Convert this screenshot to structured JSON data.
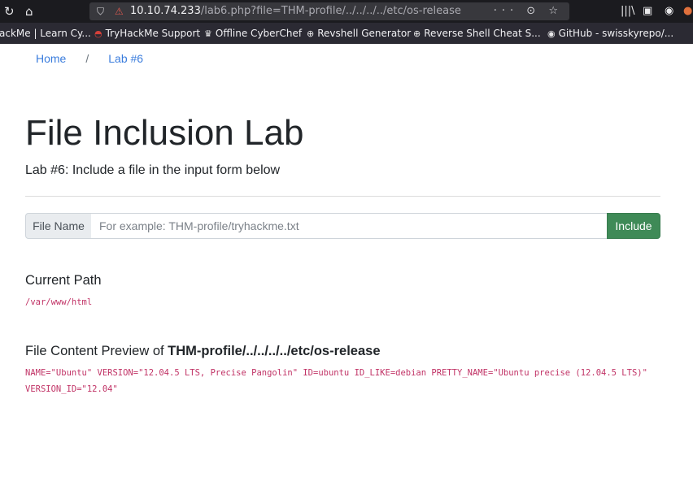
{
  "browser": {
    "toolbar": {
      "reload_icon": "reload-icon",
      "home_icon": "home-icon",
      "shield_icon": "shield-icon",
      "insecure_lock_icon": "insecure-lock-icon",
      "url_host": "10.10.74.233",
      "url_rest": "/lab6.php?file=THM-profile/../../../../etc/os-release",
      "page_actions_icons": "···  ⊙  ☆",
      "library_icon": "library-icon",
      "sidebar_icon": "sidebar-icon",
      "account_icon": "account-icon"
    },
    "bookmarks": [
      {
        "label": "ackMe | Learn Cy...",
        "icon": "tryhackme-icon"
      },
      {
        "label": "TryHackMe Support",
        "icon": "tryhackme-support-icon"
      },
      {
        "label": "Offline CyberChef",
        "icon": "cyberchef-icon"
      },
      {
        "label": "Revshell Generator",
        "icon": "globe-icon"
      },
      {
        "label": "Reverse Shell Cheat S...",
        "icon": "globe-icon"
      },
      {
        "label": "GitHub - swisskyrepo/...",
        "icon": "github-icon"
      }
    ]
  },
  "page": {
    "breadcrumb": {
      "home": "Home",
      "separator": "/",
      "current": "Lab #6"
    },
    "title": "File Inclusion Lab",
    "subtitle": "Lab #6: Include a file in the input form below",
    "form": {
      "label": "File Name",
      "placeholder": "For example: THM-profile/tryhackme.txt",
      "value": "",
      "button": "Include"
    },
    "current_path": {
      "heading": "Current Path",
      "value": "/var/www/html"
    },
    "preview": {
      "heading_prefix": "File Content Preview of ",
      "heading_file": "THM-profile/../../../../etc/os-release",
      "content": "NAME=\"Ubuntu\" VERSION=\"12.04.5 LTS, Precise Pangolin\" ID=ubuntu ID_LIKE=debian PRETTY_NAME=\"Ubuntu precise (12.04.5 LTS)\" VERSION_ID=\"12.04\""
    }
  },
  "colors": {
    "link": "#3b7ddd",
    "code": "#c13366",
    "button_success": "#3f8a57",
    "browser_toolbar": "#1b1b1f",
    "bookmarks_bar": "#2b2a33"
  }
}
